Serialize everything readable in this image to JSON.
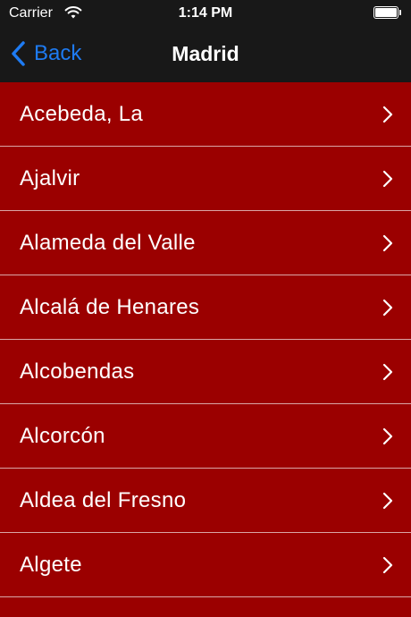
{
  "status_bar": {
    "carrier": "Carrier",
    "time": "1:14 PM",
    "icons": [
      "wifi-icon",
      "battery-icon"
    ]
  },
  "nav": {
    "back_label": "Back",
    "title": "Madrid",
    "back_icon": "chevron-left-icon"
  },
  "list": {
    "items": [
      {
        "label": "Acebeda, La"
      },
      {
        "label": "Ajalvir"
      },
      {
        "label": "Alameda del Valle"
      },
      {
        "label": "Alcalá de Henares"
      },
      {
        "label": "Alcobendas"
      },
      {
        "label": "Alcorcón"
      },
      {
        "label": "Aldea del Fresno"
      },
      {
        "label": "Algete"
      }
    ],
    "accessory_icon": "chevron-right-icon"
  },
  "colors": {
    "nav_background": "#181818",
    "row_background": "#9b0000",
    "separator": "#d9a6a6",
    "back_tint": "#1e7bf2",
    "text": "#ffffff"
  }
}
